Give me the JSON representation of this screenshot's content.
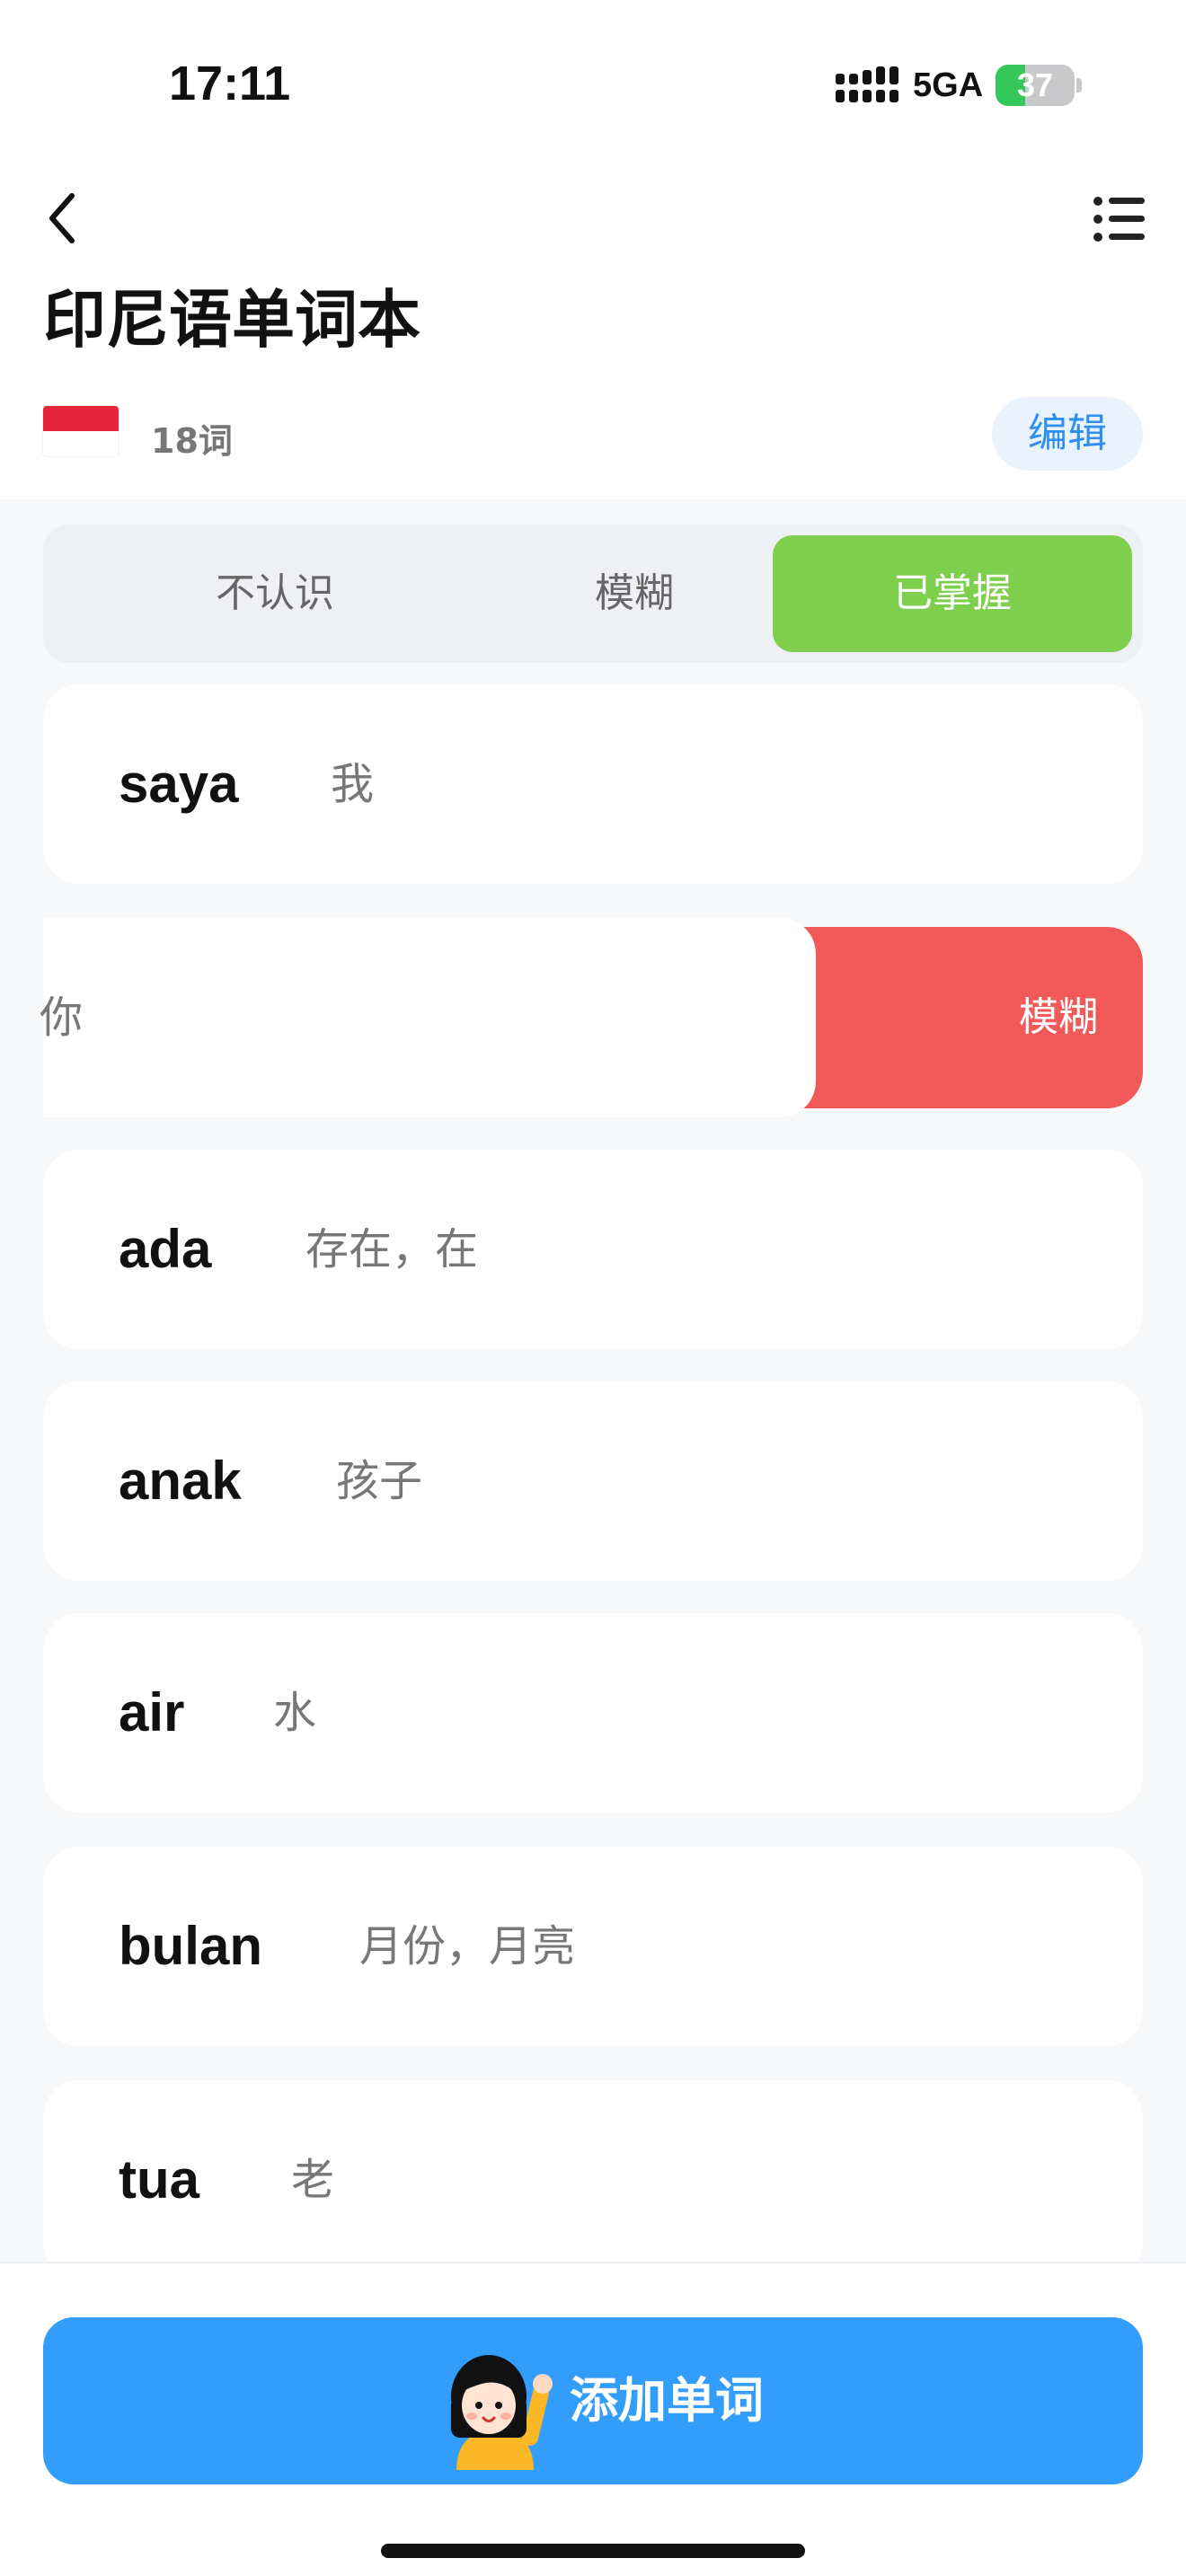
{
  "status_bar": {
    "time": "17:11",
    "network": "5GA",
    "battery": "37",
    "battery_level": 0.37
  },
  "header": {
    "back_icon": "chevron-left-icon",
    "menu_icon": "list-icon",
    "title": "印尼语单词本",
    "flag": "indonesia-flag-icon",
    "word_count": "18词",
    "edit_label": "编辑"
  },
  "tabs": [
    {
      "label": "不认识",
      "active": false
    },
    {
      "label": "模糊",
      "active": false
    },
    {
      "label": "已掌握",
      "active": true
    }
  ],
  "words": [
    {
      "word": "saya",
      "meaning": "我"
    },
    {
      "word": "",
      "meaning": "你",
      "swiped": true,
      "action_label": "模糊"
    },
    {
      "word": "ada",
      "meaning": "存在，在"
    },
    {
      "word": "anak",
      "meaning": "孩子"
    },
    {
      "word": "air",
      "meaning": "水"
    },
    {
      "word": "bulan",
      "meaning": "月份，月亮"
    },
    {
      "word": "tua",
      "meaning": "老"
    }
  ],
  "bottom": {
    "add_button_label": "添加单词",
    "avatar_icon": "waving-girl-icon"
  },
  "colors": {
    "accent_blue": "#339dfb",
    "mastered_green": "#7ecf4d",
    "swipe_red": "#f25a5a"
  }
}
